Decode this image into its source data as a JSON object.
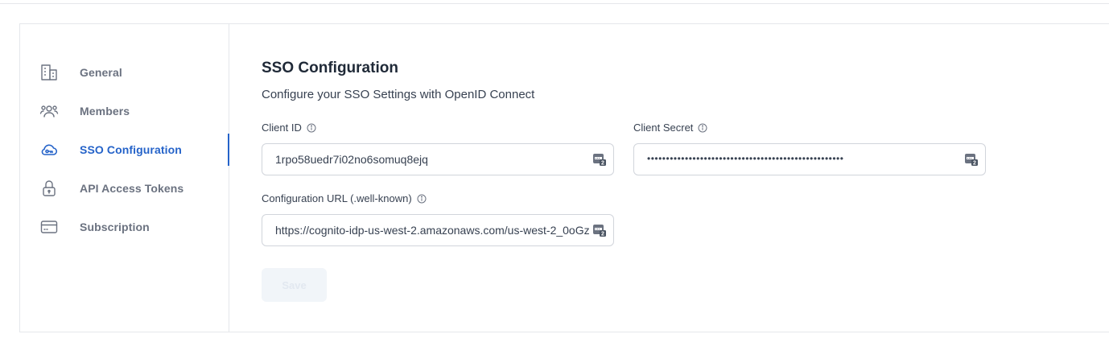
{
  "sidebar": {
    "items": [
      {
        "label": "General",
        "icon": "building-icon",
        "active": false
      },
      {
        "label": "Members",
        "icon": "users-icon",
        "active": false
      },
      {
        "label": "SSO Configuration",
        "icon": "cloud-key-icon",
        "active": true
      },
      {
        "label": "API Access Tokens",
        "icon": "lock-icon",
        "active": false
      },
      {
        "label": "Subscription",
        "icon": "credit-card-icon",
        "active": false
      }
    ]
  },
  "main": {
    "title": "SSO Configuration",
    "subtitle": "Configure your SSO Settings with OpenID Connect",
    "fields": {
      "client_id": {
        "label": "Client ID",
        "value": "1rpo58uedr7i02no6somuq8ejq"
      },
      "client_secret": {
        "label": "Client Secret",
        "value": "••••••••••••••••••••••••••••••••••••••••••••••••••••"
      },
      "config_url": {
        "label": "Configuration URL (.well-known)",
        "value": "https://cognito-idp-us-west-2.amazonaws.com/us-west-2_0oGz"
      }
    },
    "save_label": "Save"
  },
  "colors": {
    "accent": "#2563c9",
    "muted_text": "#6b7280",
    "border": "#e5e7eb",
    "disabled_button_bg": "#f1f5f9"
  }
}
